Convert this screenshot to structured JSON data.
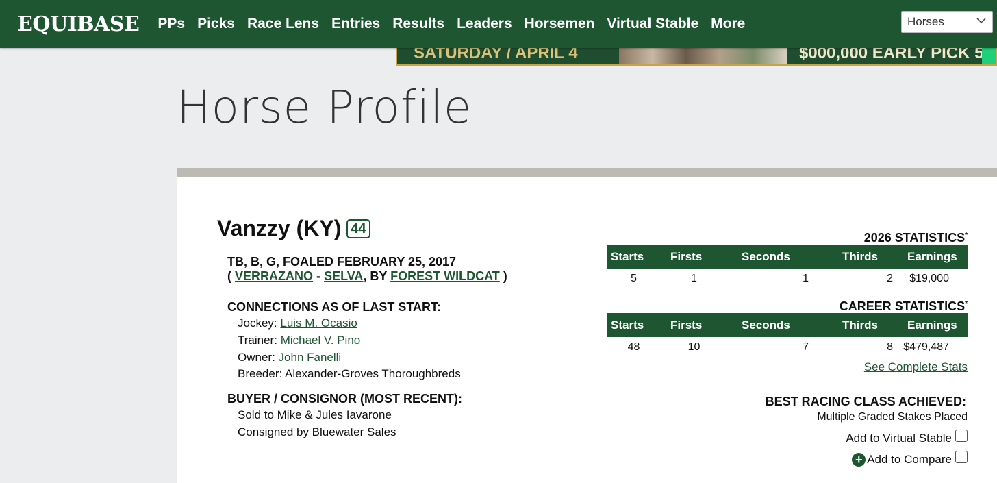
{
  "nav": {
    "logo": "EQUIBASE",
    "items": [
      "PPs",
      "Picks",
      "Race Lens",
      "Entries",
      "Results",
      "Leaders",
      "Horsemen",
      "Virtual Stable",
      "More"
    ],
    "search_type": "Horses"
  },
  "banner": {
    "left_text": "SATURDAY / APRIL 4",
    "right_text": "$000,000 EARLY PICK 5"
  },
  "page": {
    "title": "Horse Profile"
  },
  "horse": {
    "name": "Vanzzy (KY)",
    "rating": "44",
    "description": "TB, B, G, FOALED FEBRUARY 25, 2017",
    "sire": "VERRAZANO",
    "dam": "SELVA",
    "damsire": "FOREST WILDCAT",
    "by_label": ", BY",
    "open_paren": "(",
    "close_paren": ")",
    "dash": "-"
  },
  "connections": {
    "heading": "CONNECTIONS AS OF LAST START:",
    "jockey_label": "Jockey:",
    "jockey": "Luis M. Ocasio",
    "trainer_label": "Trainer:",
    "trainer": "Michael V. Pino",
    "owner_label": "Owner:",
    "owner": "John Fanelli",
    "breeder_line": "Breeder: Alexander-Groves Thoroughbreds"
  },
  "sales": {
    "heading": "BUYER / CONSIGNOR (MOST RECENT):",
    "sold": "Sold to Mike & Jules Iavarone",
    "consigned": "Consigned by Bluewater Sales"
  },
  "stats": {
    "headers": [
      "Starts",
      "Firsts",
      "Seconds",
      "Thirds",
      "Earnings"
    ],
    "year_title": "2026 STATISTICS",
    "year_values": [
      "5",
      "1",
      "1",
      "2",
      "$19,000"
    ],
    "career_title": "CAREER STATISTICS",
    "career_values": [
      "48",
      "10",
      "7",
      "8",
      "$479,487"
    ],
    "asterisk": "*",
    "see_complete": "See Complete Stats",
    "best_class_heading": "BEST RACING CLASS ACHIEVED:",
    "best_class": "Multiple Graded Stakes Placed",
    "add_virtual_stable": "Add to Virtual Stable",
    "add_compare": "Add to Compare"
  },
  "colors": {
    "brand_green": "#1e5631",
    "card_border": "#bcbab2",
    "page_bg": "#ecedef"
  }
}
